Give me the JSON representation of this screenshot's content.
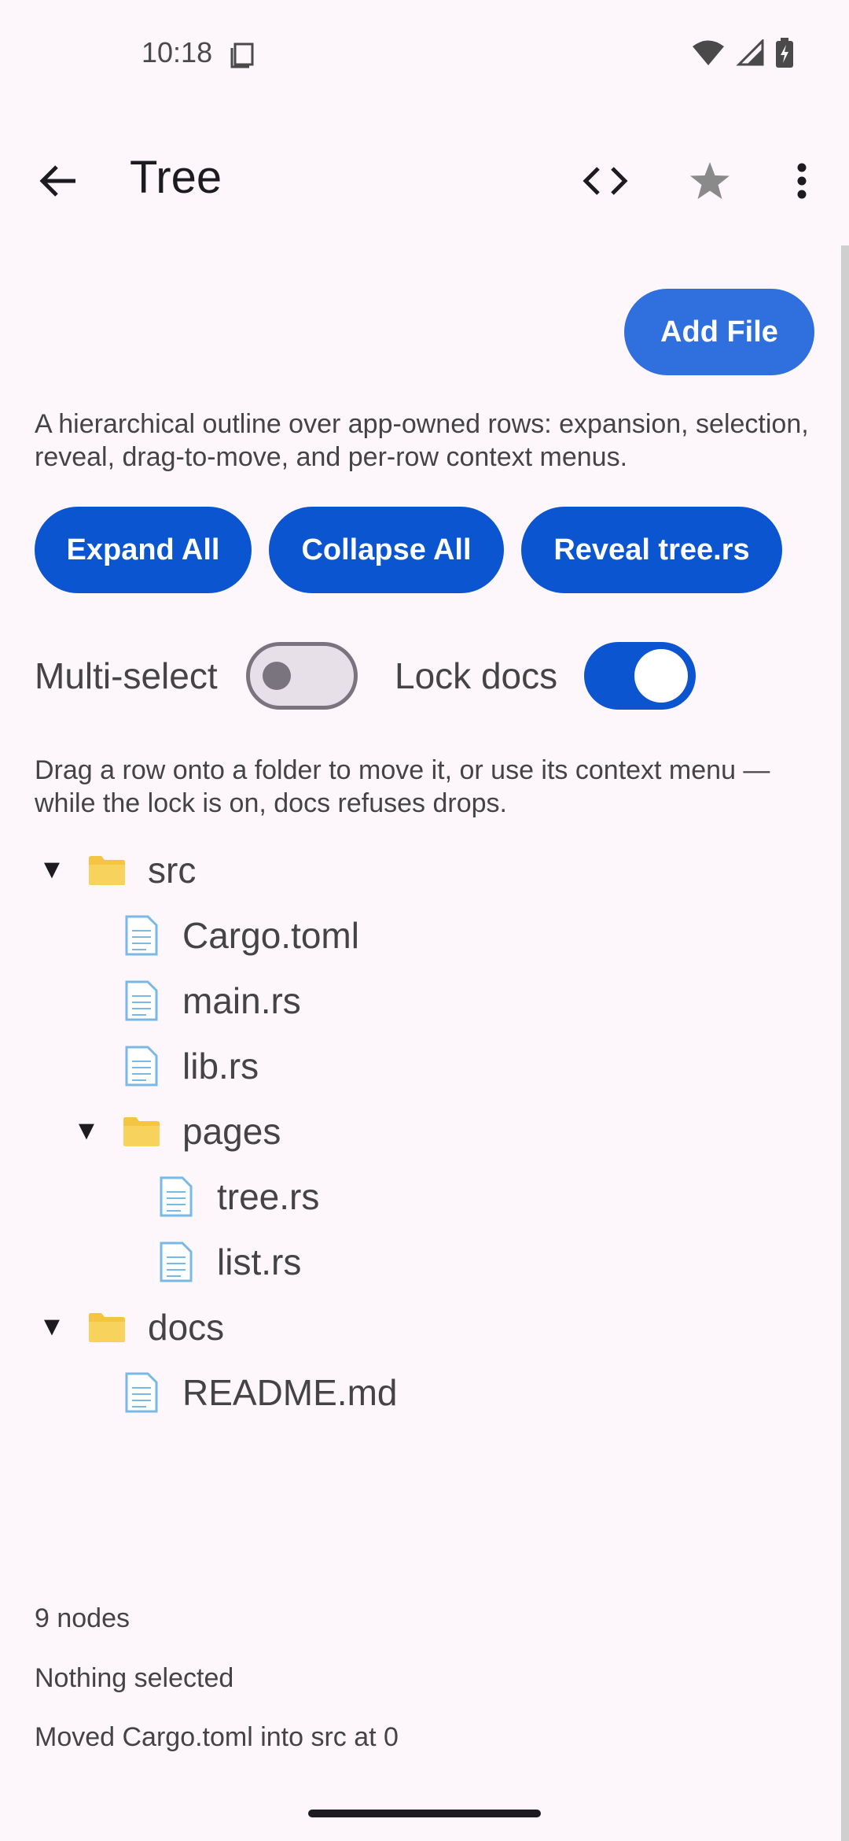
{
  "status_bar": {
    "time": "10:18",
    "icons": [
      "notification-icon",
      "wifi-icon",
      "signal-icon",
      "battery-charging-icon"
    ]
  },
  "app_bar": {
    "title": "Tree",
    "icons": [
      "back-arrow-icon",
      "code-icon",
      "star-icon",
      "more-vert-icon"
    ]
  },
  "actions": {
    "add_file": "Add File",
    "expand_all": "Expand All",
    "collapse_all": "Collapse All",
    "reveal": "Reveal tree.rs"
  },
  "description": "A hierarchical outline over app-owned rows: expansion, selection, reveal, drag-to-move, and per-row context menus.",
  "toggles": {
    "multi_select": {
      "label": "Multi-select",
      "on": false
    },
    "lock_docs": {
      "label": "Lock docs",
      "on": true
    }
  },
  "hint": "Drag a row onto a folder to move it, or use its context menu — while the lock is on, docs refuses drops.",
  "tree": [
    {
      "label": "src",
      "type": "folder",
      "expanded": true,
      "depth": 0,
      "disclosure": "▼"
    },
    {
      "label": "Cargo.toml",
      "type": "file",
      "depth": 1
    },
    {
      "label": "main.rs",
      "type": "file",
      "depth": 1
    },
    {
      "label": "lib.rs",
      "type": "file",
      "depth": 1
    },
    {
      "label": "pages",
      "type": "folder",
      "expanded": true,
      "depth": 1,
      "disclosure": "▼"
    },
    {
      "label": "tree.rs",
      "type": "file",
      "depth": 2
    },
    {
      "label": "list.rs",
      "type": "file",
      "depth": 2
    },
    {
      "label": "docs",
      "type": "folder",
      "expanded": true,
      "depth": 0,
      "disclosure": "▼"
    },
    {
      "label": "README.md",
      "type": "file",
      "depth": 1
    }
  ],
  "footer": {
    "node_count": "9 nodes",
    "selection": "Nothing selected",
    "last_action": "Moved Cargo.toml into src at 0"
  },
  "colors": {
    "background": "#fdf7fc",
    "primary": "#0b55d0",
    "add_file_button": "#2f6fde",
    "folder": "#f4c542",
    "file": "#7ab8e6"
  }
}
